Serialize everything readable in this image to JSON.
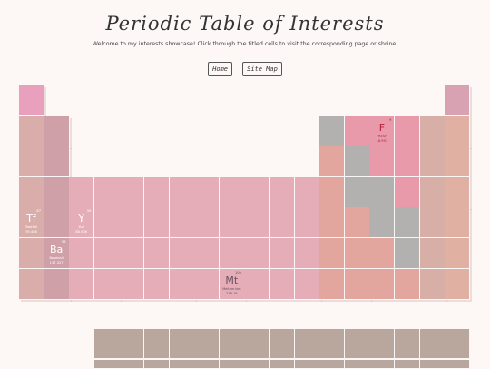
{
  "header": {
    "title": "Periodic Table of Interests",
    "subtitle": "Welcome to my interests showcase! Click through the titled cells to visit the corresponding page or shrine."
  },
  "nav": {
    "home_label": "Home",
    "sitemap_label": "Site Map"
  },
  "colors": {
    "background": "#fdf7f6",
    "group1": "#e8a0bd",
    "alkali": "#d9aeaa",
    "alkaline_earth": "#cfa0a8",
    "transition": "#e4adb8",
    "post_transition": "#e2a69e",
    "metalloid": "#b3b0b0",
    "nonmetal": "#e89aaa",
    "halogen": "#d8afa7",
    "noble_gas": "#e0b0a2",
    "top_right": "#d9a2b2",
    "lanthanide_row": "#b9a79e"
  },
  "elements": {
    "tf": {
      "number": "87",
      "symbol": "Tf",
      "name": "Taskfall",
      "mass": "95.468"
    },
    "y": {
      "number": "39",
      "symbol": "Y",
      "name": "Yuri",
      "mass": "88.906"
    },
    "ba": {
      "number": "56",
      "symbol": "Ba",
      "name": "Baseball",
      "mass": "137.327"
    },
    "mt": {
      "number": "109",
      "symbol": "Mt",
      "name": "Meitnerium",
      "mass": "278.16"
    },
    "f": {
      "number": "9",
      "symbol": "F",
      "name": "FRESH",
      "mass": "18.997"
    }
  }
}
